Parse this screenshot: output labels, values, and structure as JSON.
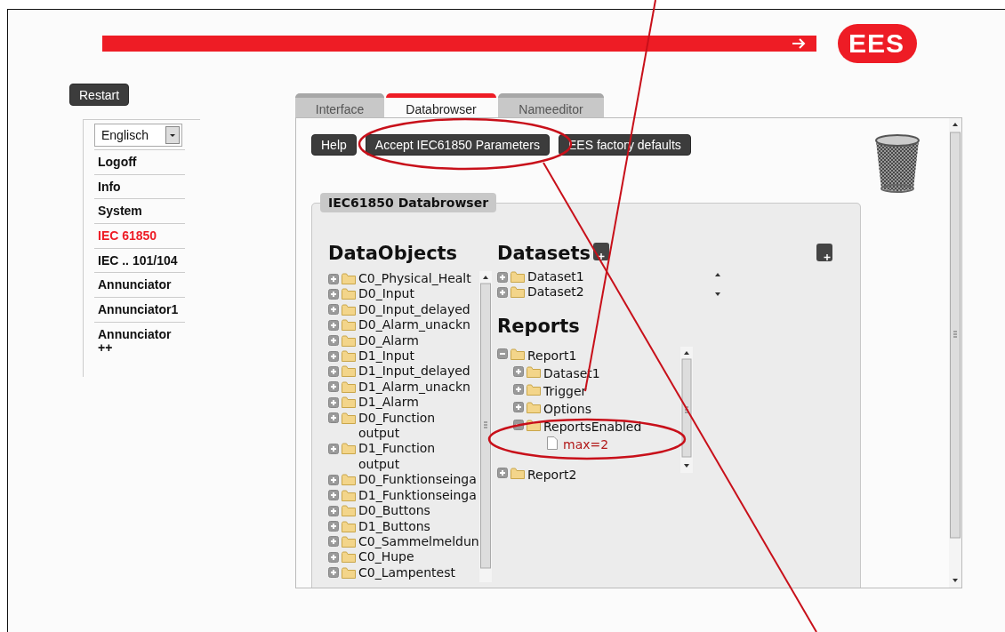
{
  "header": {
    "logo": "EES"
  },
  "restart_button": "Restart",
  "nav": {
    "language": {
      "value": "Englisch"
    },
    "items": [
      {
        "label": "Logoff",
        "selected": false
      },
      {
        "label": "Info",
        "selected": false
      },
      {
        "label": "System",
        "selected": false
      },
      {
        "label": "IEC 61850",
        "selected": true
      },
      {
        "label": "IEC .. 101/104",
        "selected": false
      },
      {
        "label": "Annunciator",
        "selected": false
      },
      {
        "label": "Annunciator1",
        "selected": false
      },
      {
        "label": "Annunciator ++",
        "selected": false
      }
    ]
  },
  "tabs": [
    {
      "label": "Interface",
      "selected": false
    },
    {
      "label": "Databrowser",
      "selected": true
    },
    {
      "label": "Nameeditor",
      "selected": false
    }
  ],
  "toolbar": [
    "Help",
    "Accept IEC61850 Parameters",
    "EES factory defaults"
  ],
  "databrowser": {
    "title": "IEC61850 Databrowser",
    "dataobjects": {
      "title": "DataObjects",
      "items": [
        {
          "label": "C0_Physical_Healt",
          "expanded": false
        },
        {
          "label": "D0_Input",
          "expanded": false
        },
        {
          "label": "D0_Input_delayed",
          "expanded": false
        },
        {
          "label": "D0_Alarm_unackn",
          "expanded": false
        },
        {
          "label": "D0_Alarm",
          "expanded": false
        },
        {
          "label": "D1_Input",
          "expanded": false
        },
        {
          "label": "D1_Input_delayed",
          "expanded": false
        },
        {
          "label": "D1_Alarm_unackn",
          "expanded": false
        },
        {
          "label": "D1_Alarm",
          "expanded": false
        },
        {
          "label": "D0_Function output",
          "expanded": false
        },
        {
          "label": "D1_Function output",
          "expanded": false
        },
        {
          "label": "D0_Funktionseinga",
          "expanded": false
        },
        {
          "label": "D1_Funktionseinga",
          "expanded": false
        },
        {
          "label": "D0_Buttons",
          "expanded": false
        },
        {
          "label": "D1_Buttons",
          "expanded": false
        },
        {
          "label": "C0_Sammelmeldun",
          "expanded": false
        },
        {
          "label": "C0_Hupe",
          "expanded": false
        },
        {
          "label": "C0_Lampentest",
          "expanded": false
        }
      ]
    },
    "datasets": {
      "title": "Datasets",
      "items": [
        {
          "label": "Dataset1",
          "expanded": false
        },
        {
          "label": "Dataset2",
          "expanded": false
        }
      ]
    },
    "reports": {
      "title": "Reports",
      "items": [
        {
          "kind": "folder",
          "label": "Report1",
          "expanded": true,
          "children": [
            {
              "kind": "folder",
              "label": "Dataset1",
              "expanded": false
            },
            {
              "kind": "folder",
              "label": "Trigger",
              "expanded": false
            },
            {
              "kind": "folder",
              "label": "Options",
              "expanded": false
            },
            {
              "kind": "folder",
              "label": "ReportsEnabled",
              "expanded": true,
              "children": [
                {
                  "kind": "leaf",
                  "label": "max=2"
                }
              ]
            }
          ]
        },
        {
          "kind": "folder",
          "label": "Report2",
          "expanded": false
        }
      ]
    }
  }
}
